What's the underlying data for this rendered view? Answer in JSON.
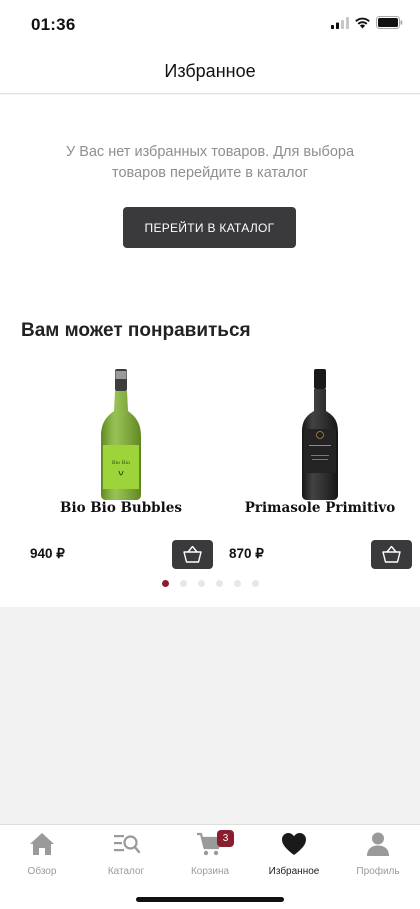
{
  "status_bar": {
    "time": "01:36"
  },
  "header": {
    "title": "Избранное"
  },
  "empty_state": {
    "message": "У Вас нет избранных товаров. Для  выбора товаров перейдите в каталог",
    "button_label": "ПЕРЕЙТИ В КАТАЛОГ"
  },
  "recommendations": {
    "title": "Вам может понравиться",
    "products": [
      {
        "name": "Bio Bio Bubbles",
        "price": "940 ₽",
        "bottle_color": "#7fb32b",
        "icon": "sparkling-wine-bottle-icon"
      },
      {
        "name": "Primasole Primitivo",
        "price": "870 ₽",
        "bottle_color": "#1a1a1a",
        "icon": "red-wine-bottle-icon"
      }
    ],
    "pagination": {
      "active_index": 0,
      "count": 6
    }
  },
  "tabbar": {
    "tabs": [
      {
        "label": "Обзор",
        "icon": "home-icon",
        "active": false
      },
      {
        "label": "Каталог",
        "icon": "catalog-search-icon",
        "active": false
      },
      {
        "label": "Корзина",
        "icon": "cart-icon",
        "active": false,
        "badge": "3"
      },
      {
        "label": "Избранное",
        "icon": "heart-icon",
        "active": true
      },
      {
        "label": "Профиль",
        "icon": "profile-icon",
        "active": false
      }
    ]
  },
  "colors": {
    "accent": "#8b1e2e",
    "button_dark": "#3a3a3c",
    "muted_text": "#8e8e8e"
  }
}
